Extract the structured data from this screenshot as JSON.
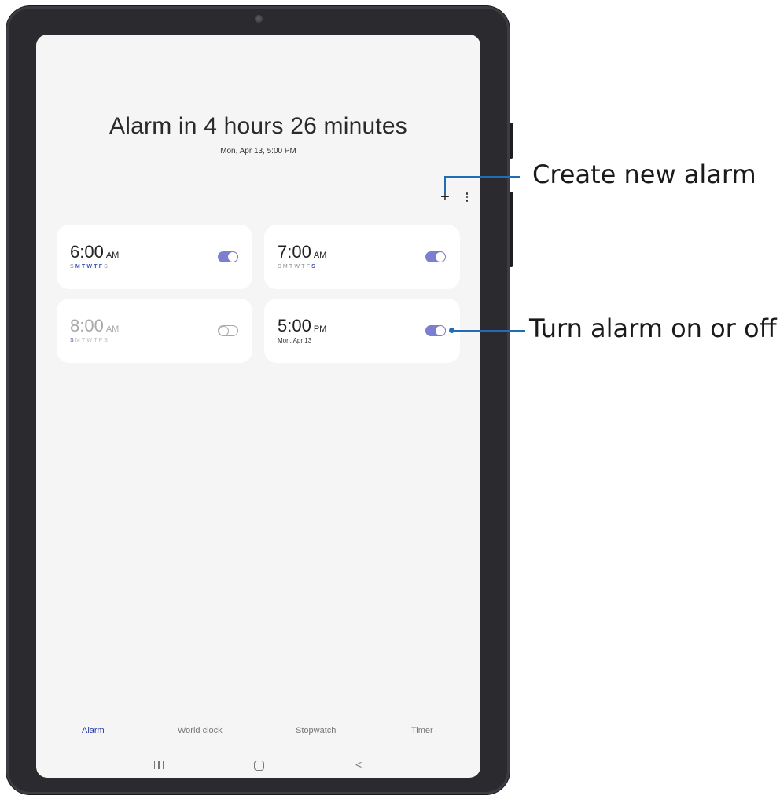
{
  "header": {
    "title": "Alarm in 4 hours 26 minutes",
    "subtitle": "Mon, Apr 13, 5:00 PM"
  },
  "toolbar": {
    "add_icon": "plus-icon",
    "add_glyph": "+",
    "more_icon": "more-vert-icon"
  },
  "alarms": [
    {
      "time": "6:00",
      "ampm": "AM",
      "enabled": true,
      "days": [
        "S",
        "M",
        "T",
        "W",
        "T",
        "F",
        "S"
      ],
      "active_days": [
        false,
        true,
        true,
        true,
        true,
        true,
        false
      ]
    },
    {
      "time": "7:00",
      "ampm": "AM",
      "enabled": true,
      "days": [
        "S",
        "M",
        "T",
        "W",
        "T",
        "F",
        "S"
      ],
      "active_days": [
        false,
        false,
        false,
        false,
        false,
        false,
        true
      ]
    },
    {
      "time": "8:00",
      "ampm": "AM",
      "enabled": false,
      "days": [
        "S",
        "M",
        "T",
        "W",
        "T",
        "F",
        "S"
      ],
      "active_days": [
        true,
        false,
        false,
        false,
        false,
        false,
        false
      ]
    },
    {
      "time": "5:00",
      "ampm": "PM",
      "enabled": true,
      "date": "Mon, Apr 13"
    }
  ],
  "tabs": [
    {
      "label": "Alarm",
      "selected": true
    },
    {
      "label": "World clock",
      "selected": false
    },
    {
      "label": "Stopwatch",
      "selected": false
    },
    {
      "label": "Timer",
      "selected": false
    }
  ],
  "navbar": {
    "recent_icon": "recent-apps-icon",
    "home_icon": "home-icon",
    "back_icon": "back-icon",
    "back_glyph": "<"
  },
  "callouts": {
    "create": "Create new alarm",
    "toggle": "Turn alarm on or off"
  },
  "colors": {
    "accent": "#3a4fb8",
    "toggle_on": "#7c7fd0",
    "callout_line": "#1f6db5",
    "device": "#2b2b2f",
    "screen_bg": "#f5f5f5"
  }
}
